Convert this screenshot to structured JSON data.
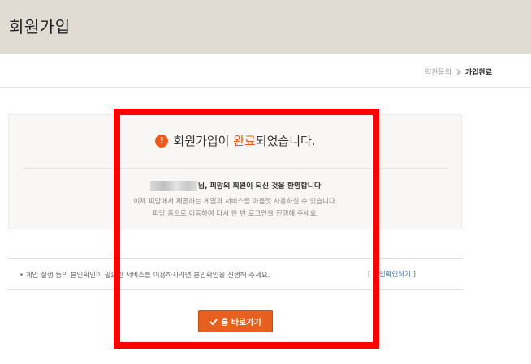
{
  "header": {
    "title": "회원가입"
  },
  "breadcrumb": {
    "items": [
      {
        "label": "약관동의"
      },
      {
        "label": "가입완료",
        "current": true
      }
    ]
  },
  "result": {
    "headline_prefix": "회원가입이 ",
    "headline_accent": "완료",
    "headline_suffix": "되었습니다.",
    "welcome": "님, 피망의 회원이 되신 것을 환영합니다",
    "desc_line1": "이제 피망에서 제공하는 게임과 서비스를 마음껏 사용하실 수 있습니다.",
    "desc_line2": "피망 홈으로 이동하여 다시 한 번 로그인을 진행해 주세요."
  },
  "notice": {
    "text": "• 게임 실행 등의 본인확인이 필요한 서비스를 이용하시려면 본인확인을 진행해 주세요.",
    "link_open": "[ ",
    "link_label": "본인확인하기",
    "link_close": " ]"
  },
  "home_button": {
    "label": "홈 바로가기"
  },
  "colors": {
    "header_bg": "#e1dcd3",
    "accent": "#e8541a",
    "button_bg": "#e8601f",
    "highlight_frame": "#ff0000"
  },
  "icons": {
    "alert": "exclamation-circle-icon",
    "breadcrumb_sep": "chevron-right-icon",
    "button": "check-icon"
  }
}
